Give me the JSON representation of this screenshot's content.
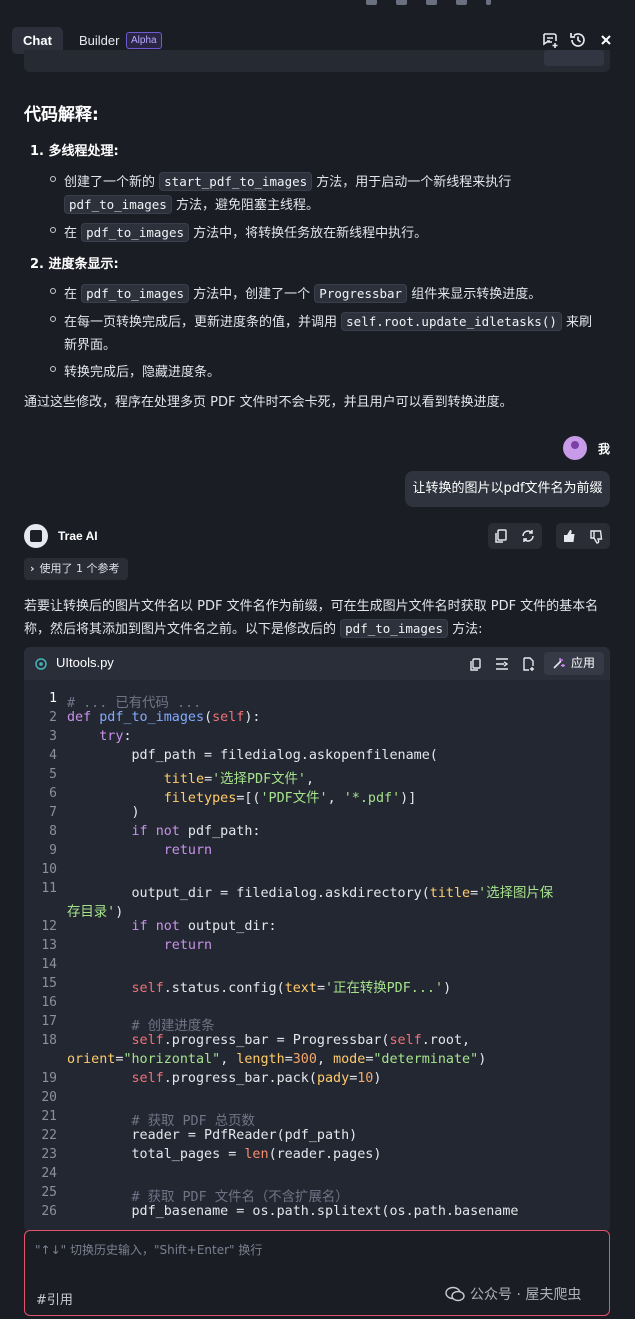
{
  "header": {
    "tab_chat": "Chat",
    "tab_builder": "Builder",
    "builder_badge": "Alpha"
  },
  "explanation": {
    "title": "代码解释:",
    "item1_title": "1. 多线程处理:",
    "item1_a_pre": "创建了一个新的",
    "item1_a_code": "start_pdf_to_images",
    "item1_a_post": "方法，用于启动一个新线程来执行",
    "item1_a2_code": "pdf_to_images",
    "item1_a2_post": "方法，避免阻塞主线程。",
    "item1_b_pre": "在",
    "item1_b_code": "pdf_to_images",
    "item1_b_post": "方法中，将转换任务放在新线程中执行。",
    "item2_title": "2. 进度条显示:",
    "item2_a_pre": "在",
    "item2_a_code": "pdf_to_images",
    "item2_a_mid": "方法中，创建了一个",
    "item2_a_code2": "Progressbar",
    "item2_a_post": "组件来显示转换进度。",
    "item2_b_pre": "在每一页转换完成后，更新进度条的值，并调用",
    "item2_b_code": "self.root.update_idletasks()",
    "item2_b_post": "来刷",
    "item2_b_cont": "新界面。",
    "item2_c": "转换完成后，隐藏进度条。",
    "summary": "通过这些修改，程序在处理多页 PDF 文件时不会卡死，并且用户可以看到转换进度。"
  },
  "user_message": {
    "name": "我",
    "text": "让转换的图片以pdf文件名为前缀"
  },
  "ai_message": {
    "name": "Trae AI",
    "reference_chip": "使用了 1 个参考",
    "intro_line1": "若要让转换后的图片文件名以 PDF 文件名作为前缀，可在生成图片文件名时获取 PDF 文件的基本名",
    "intro_line2_pre": "称，然后将其添加到图片文件名之前。以下是修改后的",
    "intro_line2_code": "pdf_to_images",
    "intro_line2_post": "方法:"
  },
  "codeblock": {
    "filename": "UItools.py",
    "apply_label": "应用",
    "line_numbers": [
      "1",
      "2",
      "3",
      "4",
      "5",
      "6",
      "7",
      "8",
      "9",
      "10",
      "11",
      "",
      "12",
      "13",
      "14",
      "15",
      "16",
      "17",
      "18",
      "",
      "19",
      "20",
      "21",
      "22",
      "23",
      "24",
      "25",
      "26"
    ]
  },
  "input": {
    "placeholder": "\"↑↓\" 切换历史输入，\"Shift+Enter\" 换行",
    "cite_label": "#引用"
  },
  "watermark": "公众号 · 屋夫爬虫",
  "colors": {
    "accent_border": "#e2546d",
    "keyword": "#c792ea",
    "string": "#a5e28b",
    "function": "#82aaff",
    "number": "#f4a86a"
  }
}
